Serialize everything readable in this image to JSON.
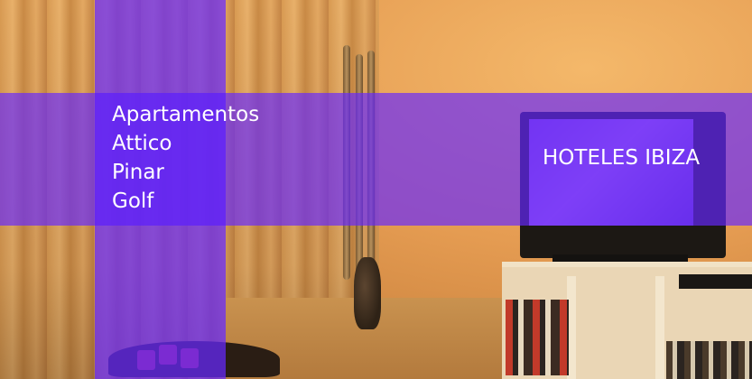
{
  "hotel": {
    "name_lines": [
      "Apartamentos",
      "Attico",
      "Pinar",
      "Golf"
    ]
  },
  "brand": {
    "text": "HOTELES IBIZA"
  },
  "colors": {
    "overlay": "#6628ff",
    "text": "#ffffff",
    "wall_warm": "#e59c52"
  }
}
